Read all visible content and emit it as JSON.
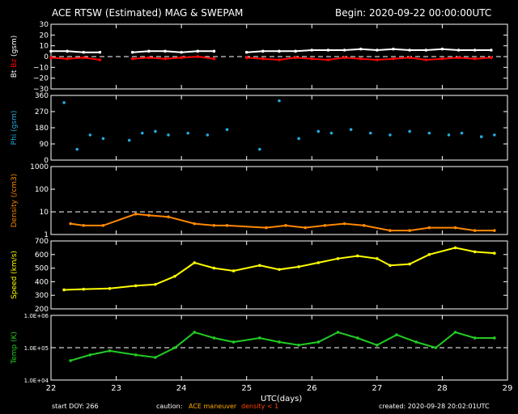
{
  "title": "ACE RTSW (Estimated) MAG & SWEPAM",
  "begin": "Begin: 2020-09-22 00:00:00UTC",
  "xlabel": "UTC(days)",
  "footer": {
    "start_doy": "start DOY: 266",
    "caution": "caution:",
    "maneuver": "ACE maneuver",
    "density_note": "density < 1",
    "created": "created: 2020-09-28 20:02:01UTC"
  },
  "colors": {
    "bt": "#ffffff",
    "bz": "#ff0000",
    "phi": "#22aadd",
    "density": "#ff8800",
    "speed": "#ffff00",
    "temp": "#22cc22",
    "maneuver": "#ffaa00",
    "density_low": "#ff4400",
    "frame": "#ffffff"
  },
  "chart_data": [
    {
      "type": "line",
      "ylabel": [
        "Bt",
        "Bz",
        "(gsm)"
      ],
      "yticks": [
        "30",
        "20",
        "10",
        "0",
        "−10",
        "−20",
        "−30"
      ],
      "ylim": [
        -30,
        30
      ],
      "x": [
        22,
        22.25,
        22.5,
        22.75,
        23,
        23.25,
        23.5,
        23.75,
        24,
        24.25,
        24.5,
        24.75,
        25,
        25.25,
        25.5,
        25.75,
        26,
        26.25,
        26.5,
        26.75,
        27,
        27.25,
        27.5,
        27.75,
        28,
        28.25,
        28.5,
        28.75
      ],
      "series": [
        {
          "name": "Bt",
          "values": [
            5,
            5,
            4,
            4,
            null,
            4,
            5,
            5,
            4,
            5,
            5,
            null,
            4,
            5,
            5,
            5,
            6,
            6,
            6,
            7,
            6,
            7,
            6,
            6,
            7,
            6,
            6,
            6
          ]
        },
        {
          "name": "Bz",
          "values": [
            -1,
            -2,
            -1,
            -3,
            null,
            -2,
            -1,
            -2,
            -1,
            0,
            -2,
            null,
            -1,
            -2,
            -3,
            -1,
            -2,
            -3,
            -1,
            -2,
            -3,
            -2,
            -1,
            -3,
            -2,
            -1,
            -2,
            -1
          ]
        }
      ]
    },
    {
      "type": "scatter",
      "ylabel": [
        "Phi",
        "(gsm)"
      ],
      "yticks": [
        "360",
        "270",
        "180",
        "90",
        "0"
      ],
      "ylim": [
        0,
        360
      ],
      "x": [
        22.2,
        22.4,
        22.6,
        22.8,
        23.2,
        23.4,
        23.6,
        23.8,
        24.1,
        24.4,
        24.7,
        25.2,
        25.5,
        25.8,
        26.1,
        26.3,
        26.6,
        26.9,
        27.2,
        27.5,
        27.8,
        28.1,
        28.3,
        28.6,
        28.8
      ],
      "series": [
        {
          "name": "Phi",
          "values": [
            320,
            60,
            140,
            120,
            110,
            150,
            160,
            140,
            150,
            140,
            170,
            60,
            330,
            120,
            160,
            150,
            170,
            150,
            140,
            160,
            150,
            140,
            150,
            130,
            140
          ]
        }
      ]
    },
    {
      "type": "line",
      "ylabel": [
        "Density",
        "(/cm3)"
      ],
      "yticks": [
        "1000",
        "100",
        "10",
        "1"
      ],
      "yscale": "log",
      "ylim": [
        1,
        1000
      ],
      "x": [
        22.3,
        22.5,
        22.8,
        23.3,
        23.5,
        23.8,
        24.2,
        24.5,
        24.7,
        25.3,
        25.6,
        25.9,
        26.2,
        26.5,
        26.8,
        27.2,
        27.5,
        27.8,
        28.2,
        28.5,
        28.8
      ],
      "series": [
        {
          "name": "Density",
          "values": [
            3,
            2.5,
            2.5,
            8,
            7,
            6,
            3,
            2.5,
            2.5,
            2,
            2.5,
            2,
            2.5,
            3,
            2.5,
            1.5,
            1.5,
            2,
            2,
            1.5,
            1.5
          ]
        }
      ]
    },
    {
      "type": "line",
      "ylabel": [
        "Speed",
        "(km/s)"
      ],
      "yticks": [
        "700",
        "600",
        "500",
        "400",
        "300",
        "200"
      ],
      "ylim": [
        200,
        700
      ],
      "x": [
        22.2,
        22.5,
        22.9,
        23.3,
        23.6,
        23.9,
        24.2,
        24.5,
        24.8,
        25.2,
        25.5,
        25.8,
        26.1,
        26.4,
        26.7,
        27,
        27.2,
        27.5,
        27.8,
        28.2,
        28.5,
        28.8
      ],
      "series": [
        {
          "name": "Speed",
          "values": [
            340,
            345,
            350,
            370,
            380,
            440,
            540,
            500,
            480,
            520,
            490,
            510,
            540,
            570,
            590,
            570,
            520,
            530,
            600,
            650,
            620,
            610
          ]
        }
      ]
    },
    {
      "type": "line",
      "ylabel": [
        "Temp",
        "(K)"
      ],
      "yticks": [
        "1.0E+06",
        "1.0E+05",
        "1.0E+04"
      ],
      "yscale": "log",
      "ylim": [
        10000,
        1000000
      ],
      "x": [
        22.3,
        22.6,
        22.9,
        23.3,
        23.6,
        23.9,
        24.2,
        24.5,
        24.8,
        25.2,
        25.5,
        25.8,
        26.1,
        26.4,
        26.7,
        27,
        27.3,
        27.6,
        27.9,
        28.2,
        28.5,
        28.8
      ],
      "series": [
        {
          "name": "Temp",
          "values": [
            40000,
            60000,
            80000,
            60000,
            50000,
            100000,
            300000,
            200000,
            150000,
            200000,
            150000,
            120000,
            150000,
            300000,
            200000,
            120000,
            250000,
            150000,
            100000,
            300000,
            200000,
            200000
          ]
        }
      ]
    }
  ],
  "xaxis": {
    "ticks": [
      "22",
      "23",
      "24",
      "25",
      "26",
      "27",
      "28",
      "29"
    ],
    "xlim": [
      22,
      29
    ]
  }
}
